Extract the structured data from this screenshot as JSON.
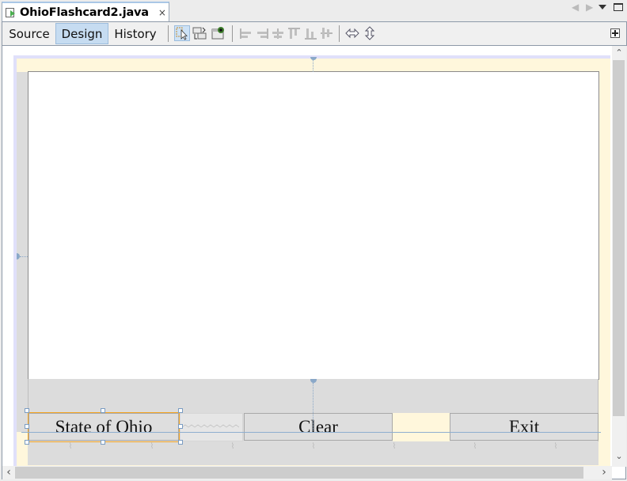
{
  "editor_tab": {
    "title": "OhioFlashcard2.java",
    "close_glyph": "×",
    "icon": "java-form-file-icon"
  },
  "tab_controls": {
    "prev_glyph": "◀",
    "next_glyph": "▶"
  },
  "toolbar": {
    "views": [
      {
        "label": "Source",
        "active": false
      },
      {
        "label": "Design",
        "active": true
      },
      {
        "label": "History",
        "active": false
      }
    ],
    "tools": [
      {
        "icon": "selection-mode-icon",
        "selected": true
      },
      {
        "icon": "connection-mode-icon",
        "selected": false
      },
      {
        "icon": "preview-design-icon",
        "selected": false
      },
      {
        "icon": "align-left-icon",
        "selected": false
      },
      {
        "icon": "align-right-icon",
        "selected": false
      },
      {
        "icon": "center-horizontally-icon",
        "selected": false
      },
      {
        "icon": "align-top-icon",
        "selected": false
      },
      {
        "icon": "align-bottom-icon",
        "selected": false
      },
      {
        "icon": "center-vertically-icon",
        "selected": false
      },
      {
        "icon": "change-horizontal-resizability-icon",
        "selected": false
      },
      {
        "icon": "change-vertical-resizability-icon",
        "selected": false
      }
    ],
    "palette_icon": "palette-toggle-icon"
  },
  "form": {
    "buttons": [
      {
        "label": "State of Ohio",
        "selected": true
      },
      {
        "label": "Clear",
        "selected": false
      },
      {
        "label": "Exit",
        "selected": false
      }
    ]
  },
  "scroll": {
    "up": "⌃",
    "down": "⌄",
    "left": "‹",
    "right": "›"
  },
  "colors": {
    "selection_outline": "#f5a623",
    "active_view_tab": "#c6dcf1",
    "form_background": "#fff7dc",
    "guide_line": "#8eaed0"
  }
}
